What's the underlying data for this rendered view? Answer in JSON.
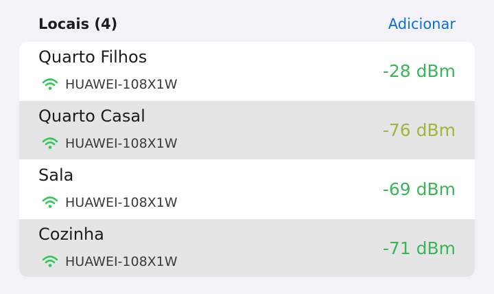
{
  "header": {
    "title": "Locais (4)",
    "action_label": "Adicionar"
  },
  "colors": {
    "accent": "#0a6fd6",
    "signal_good": "#3cb55a",
    "signal_weak": "#a0b53a",
    "wifi_icon": "#34c759"
  },
  "locations": [
    {
      "name": "Quarto Filhos",
      "ssid": "HUAWEI-108X1W",
      "signal": "-28 dBm",
      "signal_color": "#3cb55a",
      "icon": "wifi-icon"
    },
    {
      "name": "Quarto Casal",
      "ssid": "HUAWEI-108X1W",
      "signal": "-76 dBm",
      "signal_color": "#a0b53a",
      "icon": "wifi-icon"
    },
    {
      "name": "Sala",
      "ssid": "HUAWEI-108X1W",
      "signal": "-69 dBm",
      "signal_color": "#3cb55a",
      "icon": "wifi-icon"
    },
    {
      "name": "Cozinha",
      "ssid": "HUAWEI-108X1W",
      "signal": "-71 dBm",
      "signal_color": "#3cb55a",
      "icon": "wifi-icon"
    }
  ]
}
